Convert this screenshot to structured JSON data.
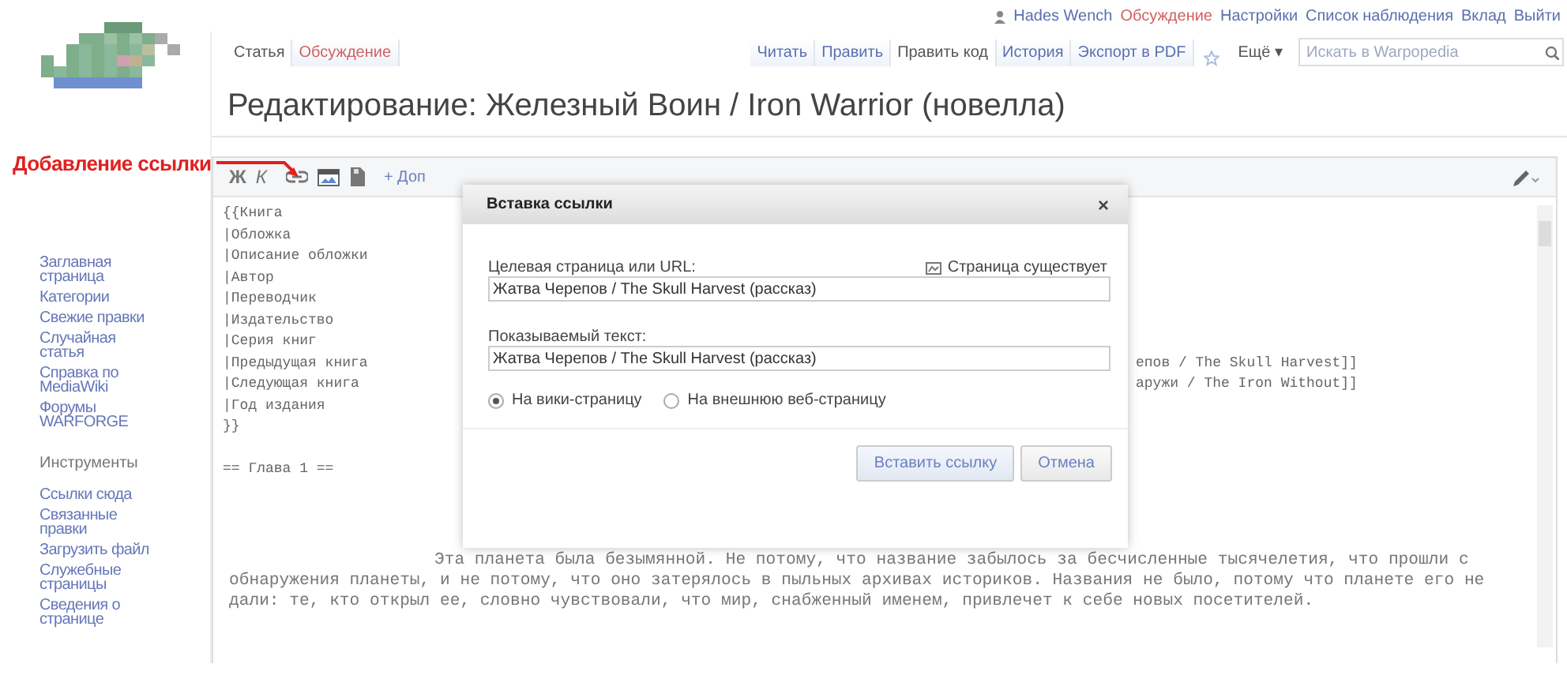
{
  "user_links": [
    {
      "label": "Hades Wench",
      "kind": "user",
      "new": false
    },
    {
      "label": "Обсуждение",
      "kind": "link",
      "new": true
    },
    {
      "label": "Настройки",
      "kind": "link",
      "new": false
    },
    {
      "label": "Список наблюдения",
      "kind": "link",
      "new": false
    },
    {
      "label": "Вклад",
      "kind": "link",
      "new": false
    },
    {
      "label": "Выйти",
      "kind": "link",
      "new": false
    }
  ],
  "namespace_tabs": [
    {
      "label": "Статья",
      "selected": true,
      "new": false
    },
    {
      "label": "Обсуждение",
      "selected": false,
      "new": true
    }
  ],
  "view_tabs": [
    {
      "label": "Читать",
      "selected": false
    },
    {
      "label": "Править",
      "selected": false
    },
    {
      "label": "Править код",
      "selected": true
    },
    {
      "label": "История",
      "selected": false
    },
    {
      "label": "Экспорт в PDF",
      "selected": false
    }
  ],
  "more_menu": "Ещё ▾",
  "search": {
    "placeholder": "Искать в Warpopedia"
  },
  "title": "Редактирование: Железный Воин / Iron Warrior (новелла)",
  "sidebar": {
    "links": [
      "Заглавная страница",
      "Категории",
      "Свежие правки",
      "Случайная статья",
      "Справка по MediaWiki",
      "Форумы WARFORGE"
    ],
    "tools_heading": "Инструменты",
    "tools": [
      "Ссылки сюда",
      "Связанные правки",
      "Загрузить файл",
      "Служебные страницы",
      "Сведения о странице"
    ]
  },
  "toolbar": {
    "bold": "Ж",
    "italic": "К",
    "advanced": "+ Доп"
  },
  "code_lines": [
    {
      "text": "{{Книга"
    },
    {
      "text": "|Обложка"
    },
    {
      "text": "|Описание обложки"
    },
    {
      "text": "|Автор"
    },
    {
      "text": "|Переводчик"
    },
    {
      "text": "|Издательство"
    },
    {
      "text": "|Серия книг"
    },
    {
      "text": "|Предыдущая книга",
      "tail": "епов / The Skull Harvest]]"
    },
    {
      "text": "|Следующая книга",
      "tail": "аружи / The Iron Without]]"
    },
    {
      "text": "|Год издания"
    },
    {
      "text": "}}"
    },
    {
      "text": "== Глава 1 ==",
      "kind": "heading"
    }
  ],
  "paragraph": "Эта планета была безымянной. Не потому, что название забылось за бесчисленные тысячелетия, что прошли с обнаружения планеты, и не потому, что оно затерялось в пыльных архивах историков. Названия не было, потому что планете его не дали: те, кто открыл ее, словно чувствовали, что мир, снабженный именем, привлечет к себе новых посетителей.",
  "annotation": "Добавление ссылки",
  "dialog": {
    "title": "Вставка ссылки",
    "close": "×",
    "target_label": "Целевая страница или URL:",
    "status": "Страница существует",
    "target_value": "Жатва Черепов / The Skull Harvest (рассказ)",
    "text_label": "Показываемый текст:",
    "text_value": "Жатва Черепов / The Skull Harvest (рассказ)",
    "options": [
      {
        "label": "На вики-страницу",
        "selected": true
      },
      {
        "label": "На внешнюю веб-страницу",
        "selected": false
      }
    ],
    "buttons": [
      {
        "label": "Вставить ссылку",
        "kind": "primary"
      },
      {
        "label": "Отмена",
        "kind": "cancel"
      }
    ]
  }
}
